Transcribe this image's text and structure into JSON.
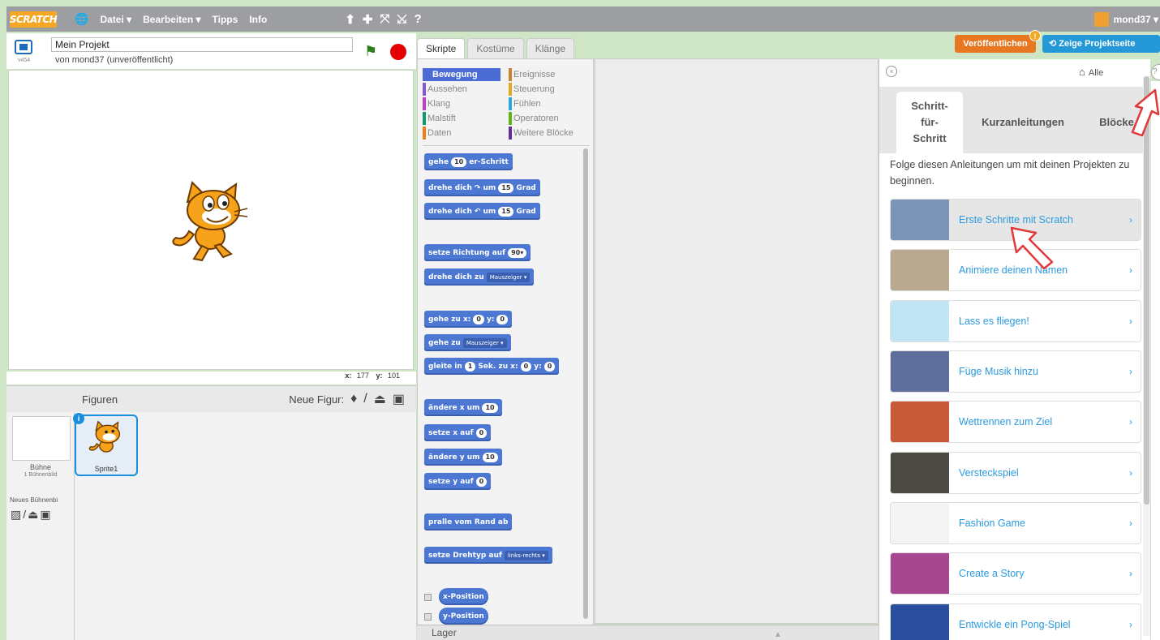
{
  "menubar": {
    "logo": "SCRATCH",
    "menus": [
      "Datei ▾",
      "Bearbeiten ▾",
      "Tipps",
      "Info"
    ],
    "tool_icons": [
      "stamp-icon",
      "grow-icon",
      "expand-icon",
      "shrink-icon",
      "help-icon"
    ],
    "user": "mond37 ▾"
  },
  "stage_header": {
    "version": "v454",
    "project_title": "Mein Projekt",
    "byline": "von mond37 (unveröffentlicht)"
  },
  "coords": {
    "x_label": "x:",
    "x": "177",
    "y_label": "y:",
    "y": "101"
  },
  "sprites": {
    "tab_label": "Figuren",
    "new_figure_label": "Neue Figur:",
    "stage_label": "Bühne",
    "stage_sub": "1 Bühnenbild",
    "new_backdrop": "Neues Bühnenbi",
    "sprite_name": "Sprite1",
    "info_badge": "i"
  },
  "script_tabs": [
    "Skripte",
    "Kostüme",
    "Klänge"
  ],
  "categories": [
    {
      "label": "Bewegung",
      "color": "#4a6cd4"
    },
    {
      "label": "Aussehen",
      "color": "#8a55d7"
    },
    {
      "label": "Klang",
      "color": "#bb42c3"
    },
    {
      "label": "Malstift",
      "color": "#0e9a6c"
    },
    {
      "label": "Daten",
      "color": "#ee7d16"
    },
    {
      "label": "Ereignisse",
      "color": "#c88330"
    },
    {
      "label": "Steuerung",
      "color": "#e1a91a"
    },
    {
      "label": "Fühlen",
      "color": "#2ca5e2"
    },
    {
      "label": "Operatoren",
      "color": "#5cb712"
    },
    {
      "label": "Weitere Blöcke",
      "color": "#632d99"
    }
  ],
  "blocks": {
    "move": {
      "a": "gehe",
      "n": "10",
      "b": "er-Schritt"
    },
    "turn_right": {
      "a": "drehe dich",
      "icon": "↷",
      "b": "um",
      "n": "15",
      "c": "Grad"
    },
    "turn_left": {
      "a": "drehe dich",
      "icon": "↶",
      "b": "um",
      "n": "15",
      "c": "Grad"
    },
    "point_dir": {
      "a": "setze Richtung auf",
      "n": "90▾"
    },
    "point_towards": {
      "a": "drehe dich zu",
      "d": "Mauszeiger ▾"
    },
    "goto_xy": {
      "a": "gehe zu x:",
      "x": "0",
      "b": "y:",
      "y": "0"
    },
    "goto": {
      "a": "gehe zu",
      "d": "Mauszeiger ▾"
    },
    "glide": {
      "a": "gleite in",
      "n": "1",
      "b": "Sek. zu x:",
      "x": "0",
      "c": "y:",
      "y": "0"
    },
    "change_x": {
      "a": "ändere x um",
      "n": "10"
    },
    "set_x": {
      "a": "setze x auf",
      "n": "0"
    },
    "change_y": {
      "a": "ändere y um",
      "n": "10"
    },
    "set_y": {
      "a": "setze y auf",
      "n": "0"
    },
    "bounce": {
      "a": "pralle vom Rand ab"
    },
    "rotation_style": {
      "a": "setze Drehtyp auf",
      "d": "links-rechts ▾"
    },
    "x_position": "x-Position",
    "y_position": "y-Position"
  },
  "lager": "Lager",
  "buttons": {
    "share": "Veröffentlichen",
    "share_badge": "!",
    "project_page": "Zeige Projektseite"
  },
  "tips": {
    "close": "×",
    "home_label": "Alle",
    "tabs": [
      "Schritt-\nfür-\nSchritt",
      "Kurzanleitungen",
      "Blöcke"
    ],
    "intro": "Folge diesen Anleitungen um mit deinen Projekten zu beginnen.",
    "items": [
      {
        "label": "Erste Schritte mit Scratch",
        "thumb": "#7c94b8"
      },
      {
        "label": "Animiere deinen Namen",
        "thumb": "#b9a98e"
      },
      {
        "label": "Lass es fliegen!",
        "thumb": "#bfe6f2"
      },
      {
        "label": "Füge Musik hinzu",
        "thumb": "#5e6f9e"
      },
      {
        "label": "Wettrennen zum Ziel",
        "thumb": "#c85a3a"
      },
      {
        "label": "Versteckspiel",
        "thumb": "#4b4b44"
      },
      {
        "label": "Fashion Game",
        "thumb": "#f4f4f4"
      },
      {
        "label": "Create a Story",
        "thumb": "#a6478f"
      },
      {
        "label": "Entwickle ein Pong-Spiel",
        "thumb": "#2b4f9c"
      }
    ],
    "help": "?"
  }
}
